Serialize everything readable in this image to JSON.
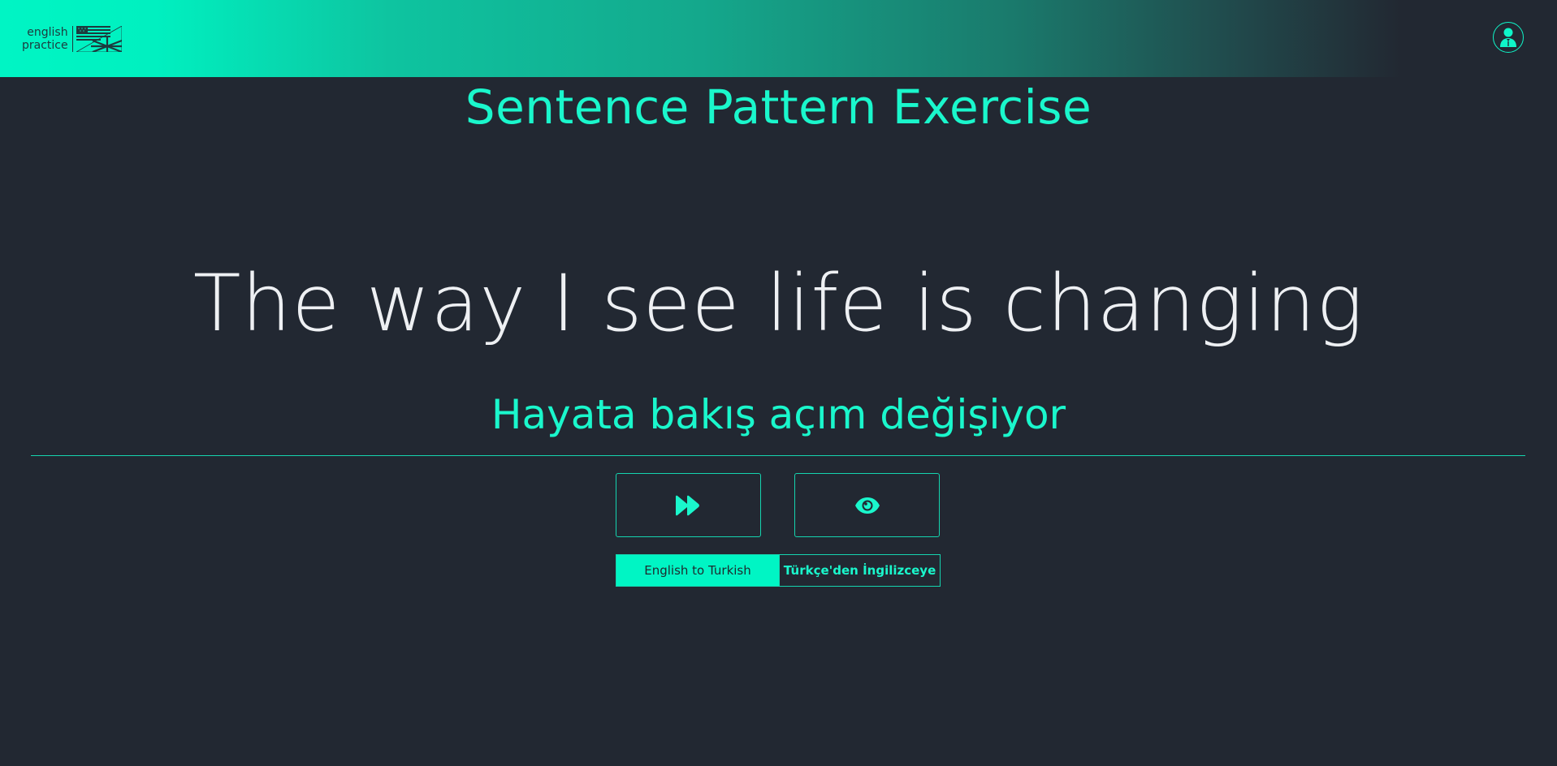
{
  "header": {
    "logo_line1": "english",
    "logo_line2": "practice",
    "logo_flag_icon": "us-uk-flag-icon",
    "avatar_icon": "user-avatar-icon"
  },
  "main": {
    "title": "Sentence Pattern Exercise",
    "sentence": "The way I see life is changing",
    "translation": "Hayata bakış açım değişiyor"
  },
  "actions": {
    "next_icon": "fast-forward-icon",
    "reveal_icon": "eye-icon"
  },
  "direction_toggle": {
    "options": [
      {
        "label": "English to Turkish",
        "selected": true
      },
      {
        "label": "Türkçe'den İngilizceye",
        "selected": false
      }
    ]
  },
  "colors": {
    "background": "#222832",
    "accent": "#00f5c4",
    "sentence_text": "#eef0f3"
  }
}
